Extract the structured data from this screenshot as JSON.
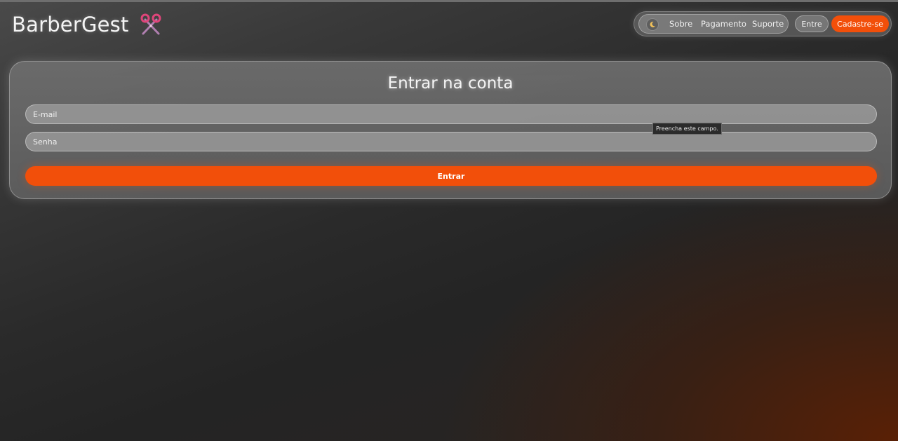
{
  "header": {
    "brand": "BarberGest",
    "brand_icon": "scissors-icon",
    "nav": {
      "theme_icon": "moon-icon",
      "links": [
        "Sobre",
        "Pagamento",
        "Suporte"
      ],
      "login_label": "Entre",
      "signup_label": "Cadastre-se"
    }
  },
  "login_form": {
    "title": "Entrar na conta",
    "email_placeholder": "E-mail",
    "password_placeholder": "Senha",
    "validation_tooltip": "Preencha este campo.",
    "submit_label": "Entrar"
  },
  "colors": {
    "accent": "#f24f0a",
    "scissors_icon": "#e0457a"
  }
}
